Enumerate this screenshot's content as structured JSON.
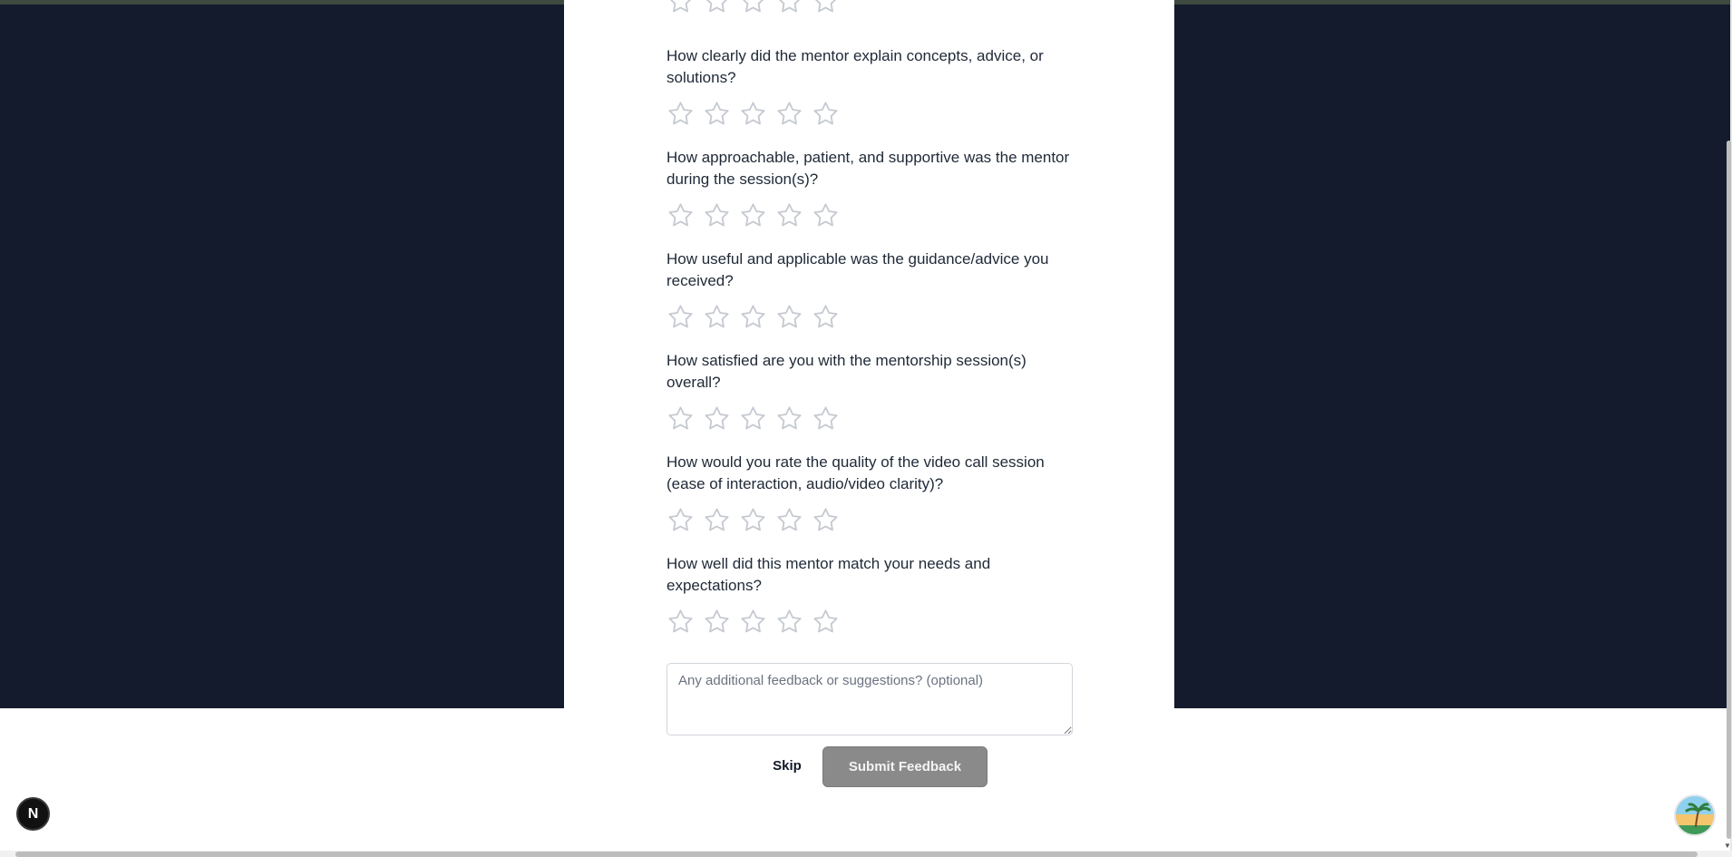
{
  "survey": {
    "questions": [
      {
        "text": "How clearly did the mentor explain concepts, advice, or solutions?",
        "rating": 0,
        "max": 5
      },
      {
        "text": "How approachable, patient, and supportive was the mentor during the session(s)?",
        "rating": 0,
        "max": 5
      },
      {
        "text": "How useful and applicable was the guidance/advice you received?",
        "rating": 0,
        "max": 5
      },
      {
        "text": "How satisfied are you with the mentorship session(s) overall?",
        "rating": 0,
        "max": 5
      },
      {
        "text": "How would you rate the quality of the video call session (ease of interaction, audio/video clarity)?",
        "rating": 0,
        "max": 5
      },
      {
        "text": "How well did this mentor match your needs and expectations?",
        "rating": 0,
        "max": 5
      }
    ],
    "feedback_placeholder": "Any additional feedback or suggestions? (optional)",
    "skip_label": "Skip",
    "submit_label": "Submit Feedback"
  },
  "dev_badge": {
    "label": "N"
  },
  "icons": {
    "star": "star-outline-icon",
    "assistant": "assistant-avatar-icon"
  },
  "colors": {
    "page_dark": "#141b2c",
    "star_stroke": "#c5c9d0",
    "submit_bg": "#8a8a8a"
  }
}
